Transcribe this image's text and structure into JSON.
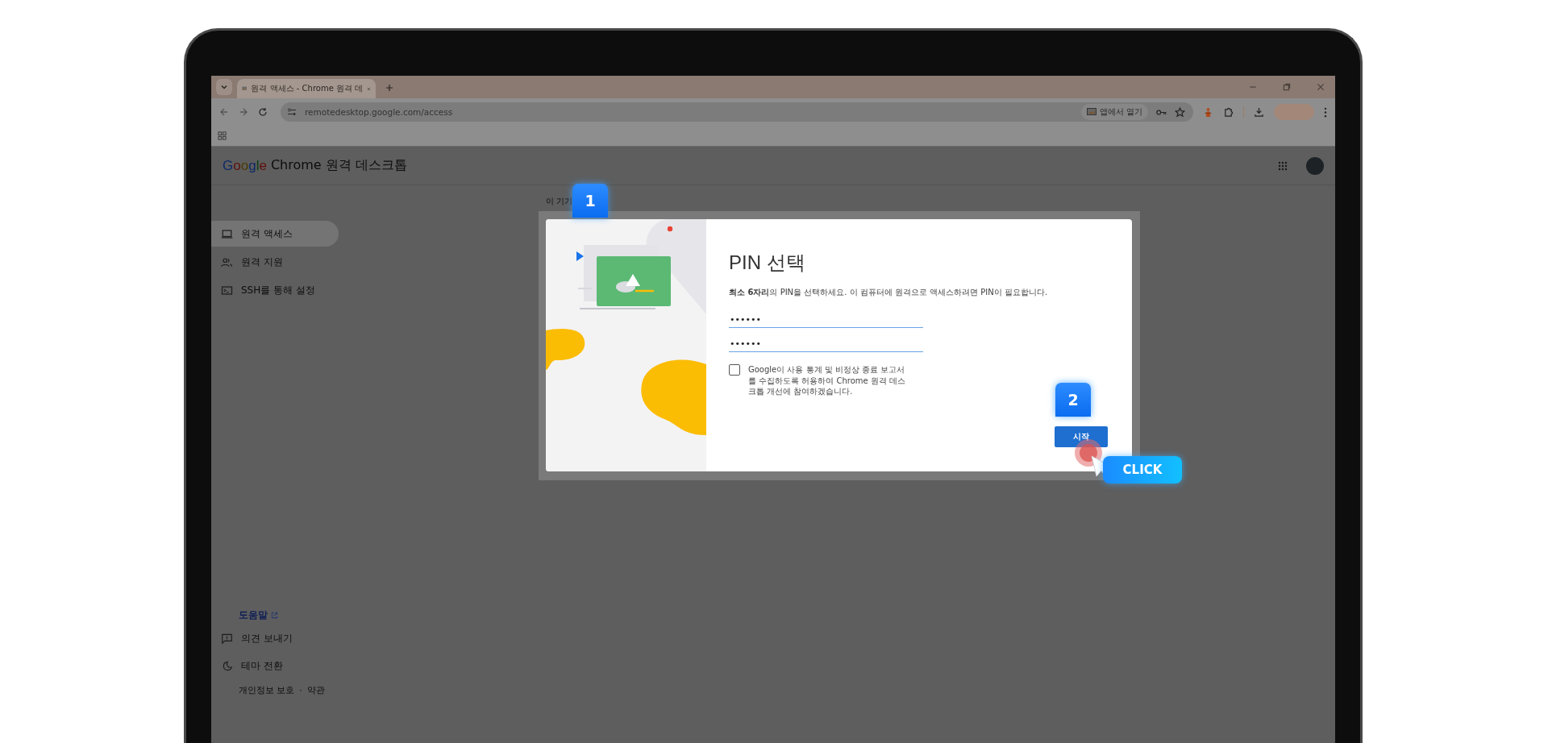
{
  "browser": {
    "tabs": [
      {
        "title": "원격 액세스 - Chrome 원격 데",
        "selected": true
      }
    ],
    "url": "remotedesktop.google.com/access",
    "open_in_app": "앱에서 열기"
  },
  "app": {
    "logo_google": "Google",
    "logo_product": "Chrome 원격 데스크톱"
  },
  "sidebar": {
    "items": [
      {
        "label": "원격 액세스",
        "kind": "laptop",
        "selected": true
      },
      {
        "label": "원격 지원",
        "kind": "people",
        "selected": false
      },
      {
        "label": "SSH를 통해 설정",
        "kind": "terminal",
        "selected": false
      }
    ],
    "help_link": "도움말",
    "footer_items": [
      {
        "label": "의견 보내기",
        "kind": "feedback"
      },
      {
        "label": "테마 전환",
        "kind": "moon"
      }
    ],
    "privacy": "개인정보 보호",
    "separator": "·",
    "terms": "약관"
  },
  "section_heading": "이 기기",
  "dialog": {
    "title": "PIN 선택",
    "description": "**최소 6자리**의 PIN을 선택하세요. 이 컴퓨터에 원격으로 액세스하려면 PIN이 필요합니다.",
    "pin_fields": [
      {
        "value": "••••••"
      },
      {
        "value": "••••••"
      }
    ],
    "consent": {
      "checked": false,
      "label": "Google이 사용 통계 및 비정상 종료 보고서를 수집하도록 허용하여 Chrome 원격 데스크톱 개선에 참여하겠습니다."
    },
    "start_button": "시작"
  },
  "annotations": [
    {
      "kind": "step",
      "text": "1"
    },
    {
      "kind": "step",
      "text": "2"
    },
    {
      "kind": "click",
      "text": "CLICK"
    }
  ]
}
